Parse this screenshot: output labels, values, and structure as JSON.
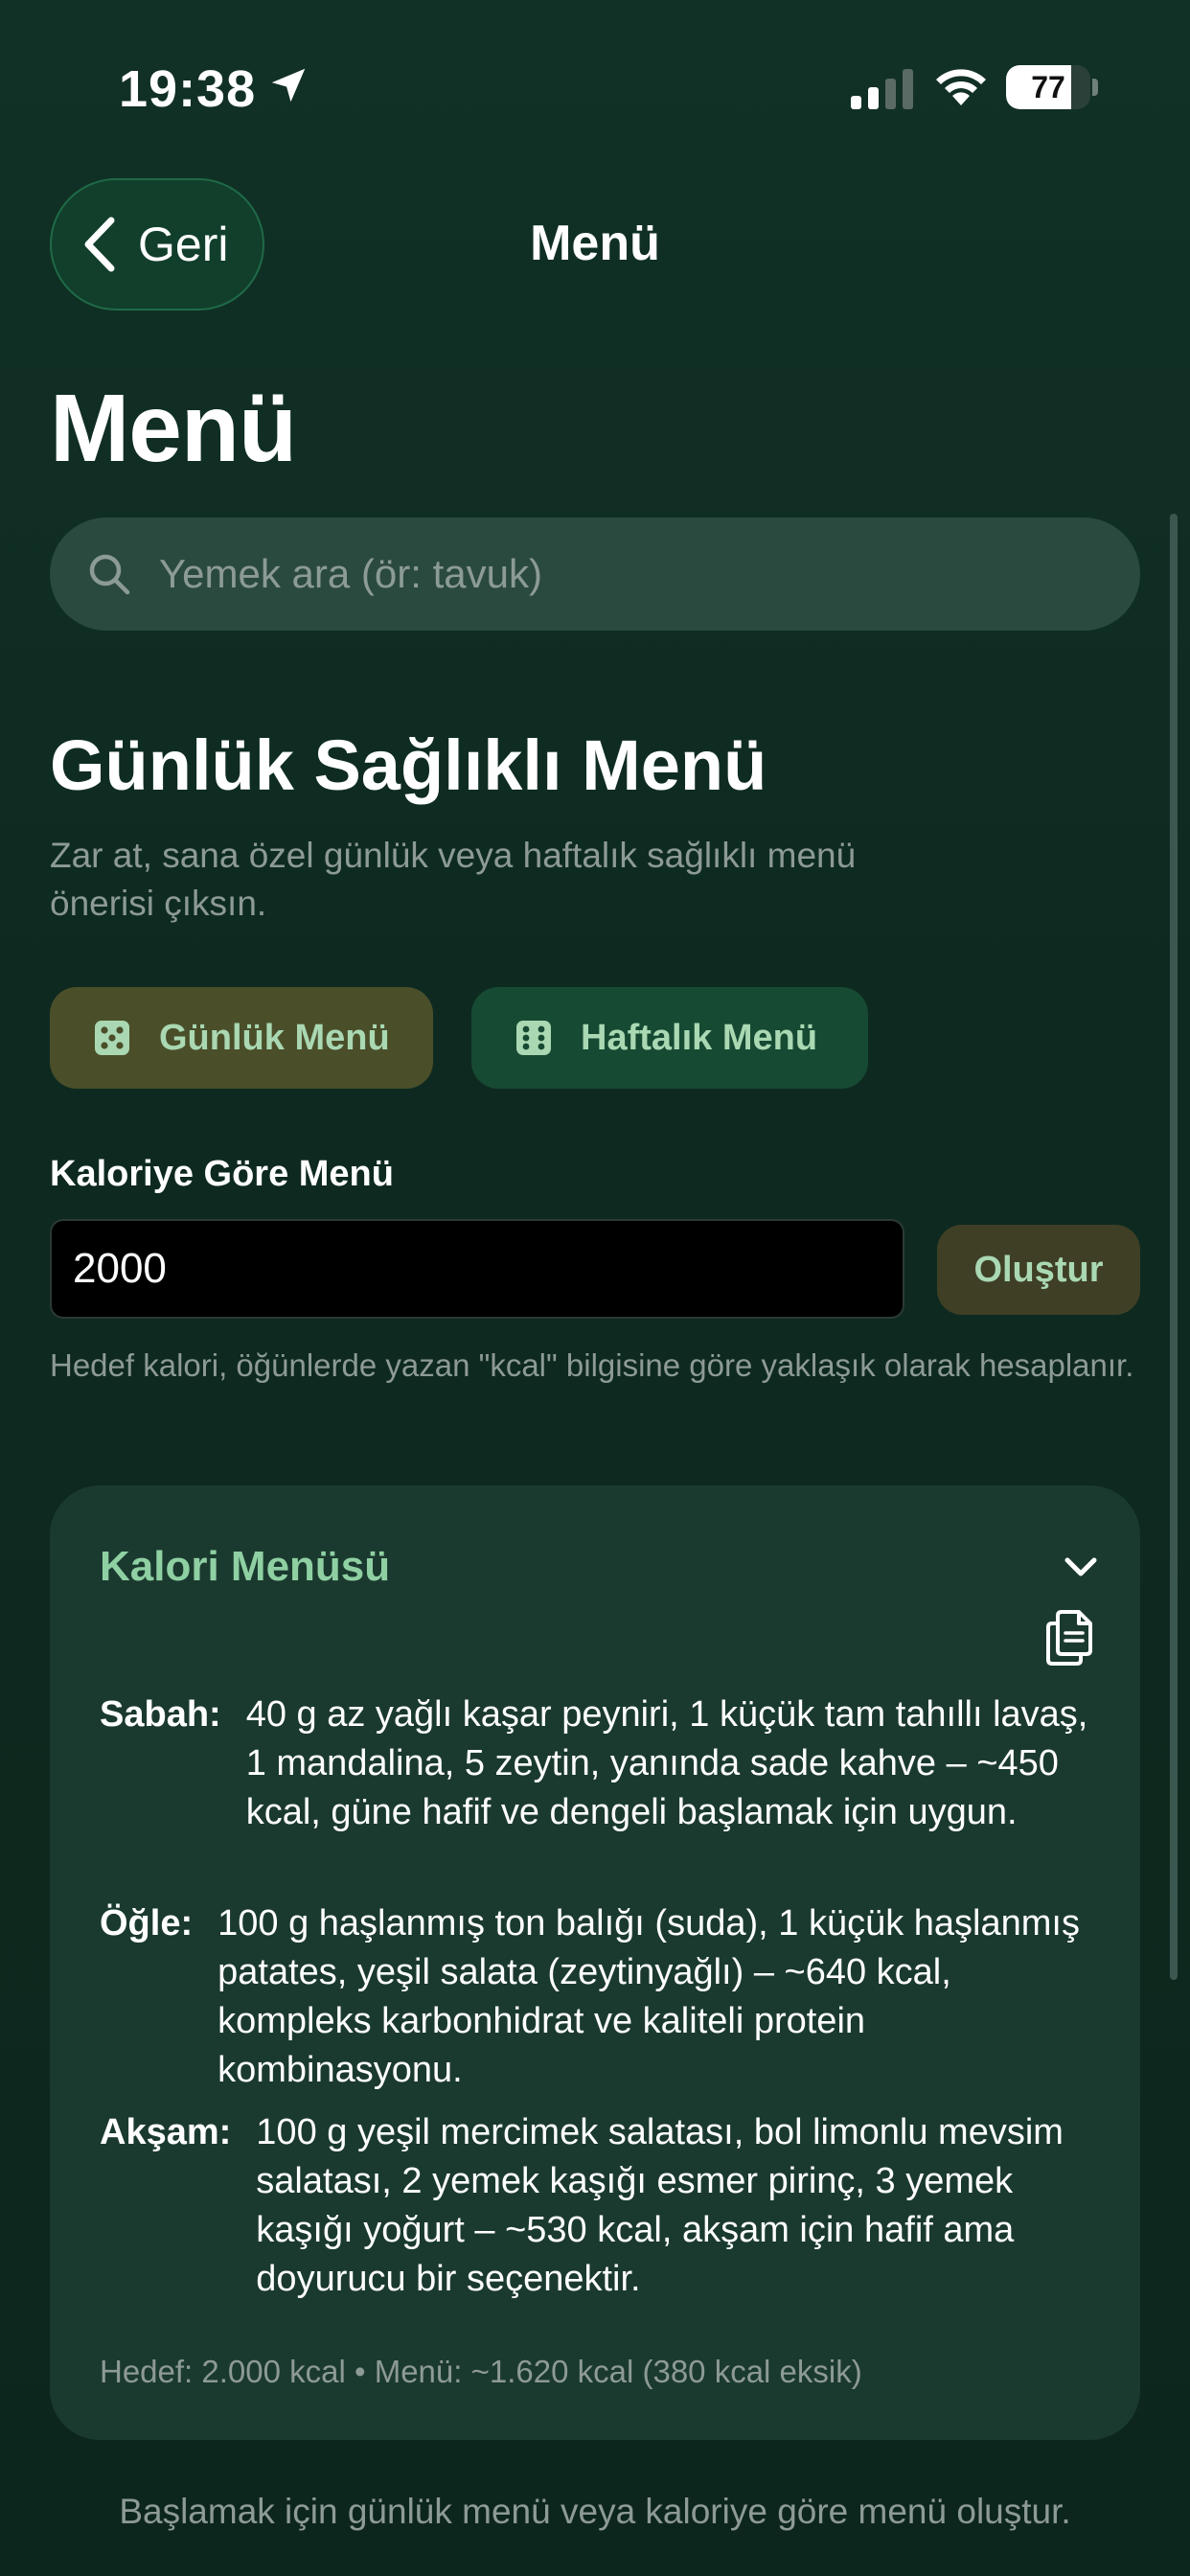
{
  "status_bar": {
    "time": "19:38",
    "battery": "77",
    "battery_level_percent": 77
  },
  "nav": {
    "back_label": "Geri",
    "title": "Menü"
  },
  "page_title": "Menü",
  "search": {
    "placeholder": "Yemek ara (ör: tavuk)",
    "value": ""
  },
  "section": {
    "title": "Günlük Sağlıklı Menü",
    "description": "Zar at, sana özel günlük veya haftalık sağlıklı menü önerisi çıksın."
  },
  "buttons": {
    "daily_menu": "Günlük Menü",
    "weekly_menu": "Haftalık Menü",
    "create": "Oluştur"
  },
  "calorie": {
    "label": "Kaloriye Göre Menü",
    "value": "2000",
    "hint": "Hedef kalori, öğünlerde yazan \"kcal\" bilgisine göre yaklaşık olarak hesaplanır."
  },
  "card": {
    "title": "Kalori Menüsü",
    "meals": [
      {
        "label": "Sabah:",
        "text": "40 g az yağlı kaşar peyniri, 1 küçük tam tahıllı lavaş, 1 mandalina, 5 zeytin, yanında sade kahve – ~450 kcal, güne hafif ve dengeli başlamak için uygun."
      },
      {
        "label": "Öğle:",
        "text": "100 g haşlanmış ton balığı (suda), 1 küçük haşlanmış patates, yeşil salata (zeytinyağlı) – ~640 kcal, kompleks karbonhidrat ve kaliteli protein kombinasyonu."
      },
      {
        "label": "Akşam:",
        "text": "100 g yeşil mercimek salatası, bol limonlu mevsim salatası, 2 yemek kaşığı esmer pirinç, 3 yemek kaşığı yoğurt – ~530 kcal, akşam için hafif ama doyurucu bir seçenektir."
      }
    ],
    "footer": "Hedef: 2.000 kcal • Menü: ~1.620 kcal (380 kcal eksik)"
  },
  "bottom_hint": "Başlamak için günlük menü veya kaloriye göre menü oluştur.",
  "colors": {
    "background": "#0f2a20",
    "accent_green": "#8fd0a3",
    "daily_button": "#4a4f2a",
    "weekly_button": "#174a33"
  },
  "icons": {
    "location": "location-arrow-icon",
    "signal": "cellular-signal-icon",
    "wifi": "wifi-icon",
    "back": "chevron-left-icon",
    "search": "search-icon",
    "dice": "dice-icon",
    "collapse": "chevron-down-icon",
    "copy": "copy-icon"
  }
}
